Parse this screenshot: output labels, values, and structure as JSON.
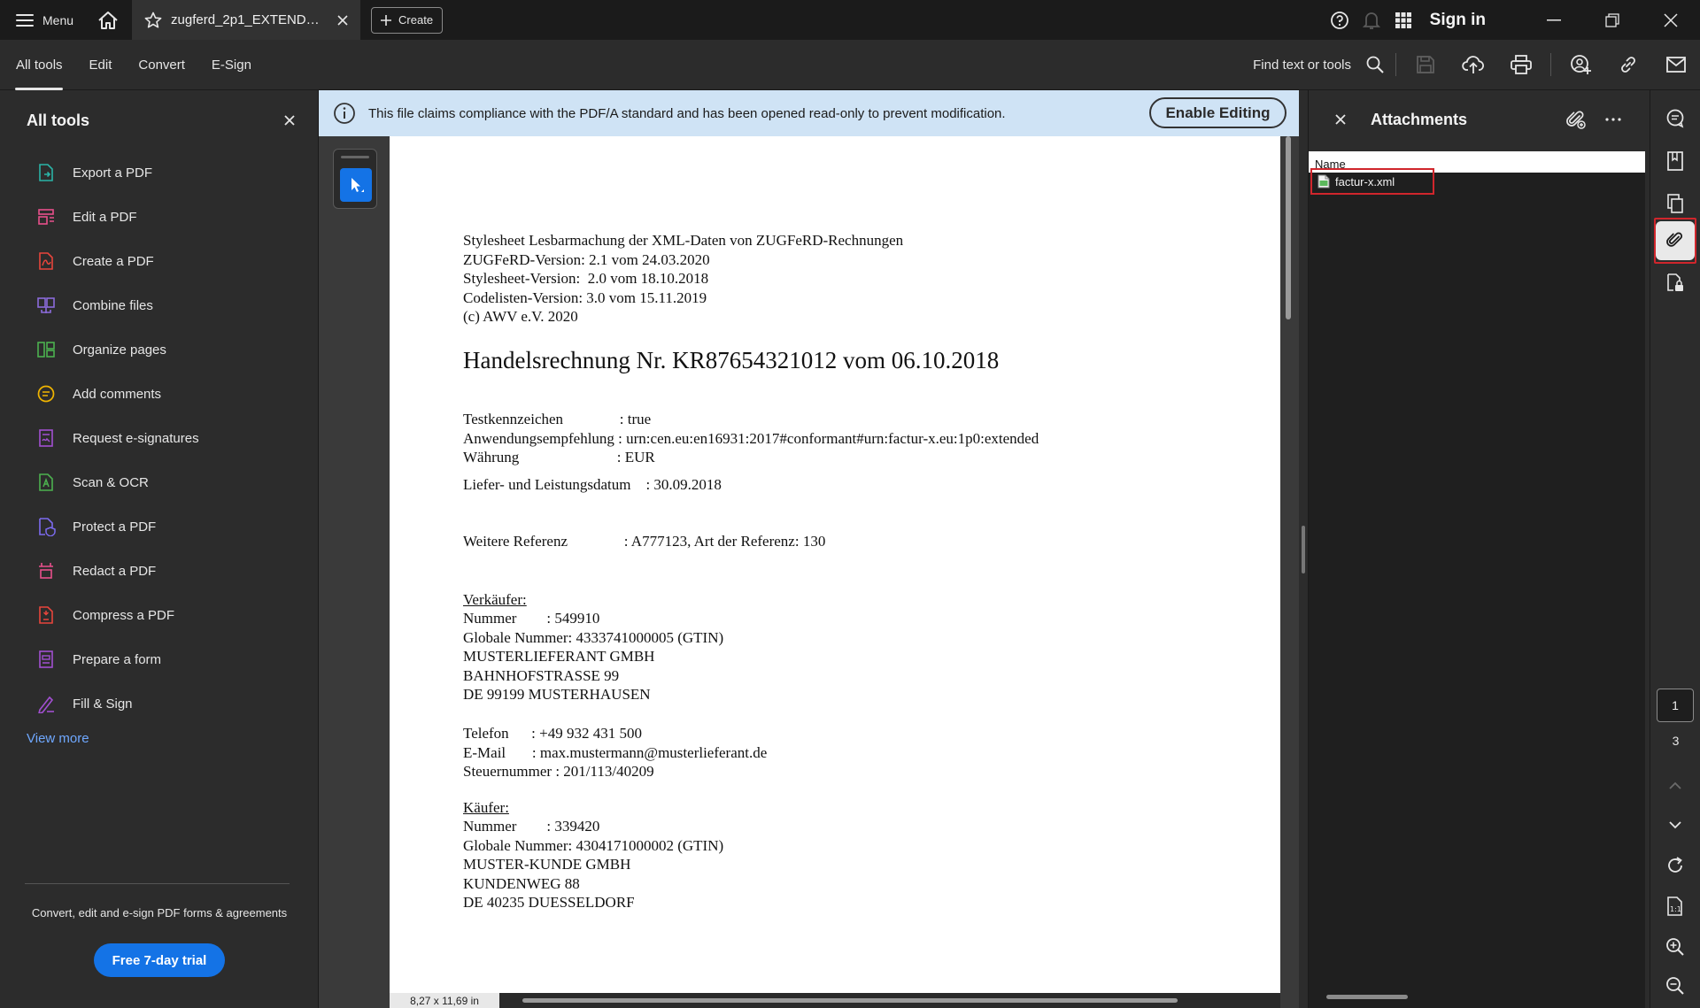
{
  "titlebar": {
    "menu_label": "Menu",
    "tab_title": "zugferd_2p1_EXTENDE...",
    "create_label": "Create",
    "signin_label": "Sign in"
  },
  "toolbar": {
    "tabs": [
      "All tools",
      "Edit",
      "Convert",
      "E-Sign"
    ],
    "find_label": "Find text or tools"
  },
  "left_panel": {
    "title": "All tools",
    "items": [
      {
        "label": "Export a PDF",
        "icon": "export-pdf-icon",
        "color": "#2ab3a6"
      },
      {
        "label": "Edit a PDF",
        "icon": "edit-pdf-icon",
        "color": "#e8508b"
      },
      {
        "label": "Create a PDF",
        "icon": "create-pdf-icon",
        "color": "#e8453c"
      },
      {
        "label": "Combine files",
        "icon": "combine-files-icon",
        "color": "#8c6bdb"
      },
      {
        "label": "Organize pages",
        "icon": "organize-pages-icon",
        "color": "#4cb14f"
      },
      {
        "label": "Add comments",
        "icon": "add-comments-icon",
        "color": "#f0b400"
      },
      {
        "label": "Request e-signatures",
        "icon": "request-esignatures-icon",
        "color": "#a24fd1"
      },
      {
        "label": "Scan & OCR",
        "icon": "scan-ocr-icon",
        "color": "#4cb14f"
      },
      {
        "label": "Protect a PDF",
        "icon": "protect-pdf-icon",
        "color": "#7c6bf0"
      },
      {
        "label": "Redact a PDF",
        "icon": "redact-pdf-icon",
        "color": "#e8508b"
      },
      {
        "label": "Compress a PDF",
        "icon": "compress-pdf-icon",
        "color": "#e8453c"
      },
      {
        "label": "Prepare a form",
        "icon": "prepare-form-icon",
        "color": "#a24fd1"
      },
      {
        "label": "Fill & Sign",
        "icon": "fill-sign-icon",
        "color": "#a24fd1"
      }
    ],
    "view_more": "View more",
    "promo_text": "Convert, edit and e-sign PDF forms & agreements",
    "trial_button": "Free 7-day trial"
  },
  "infobar": {
    "message": "This file claims compliance with the PDF/A standard and has been opened read-only to prevent modification.",
    "enable_button": "Enable Editing"
  },
  "document": {
    "header_lines": "Stylesheet Lesbarmachung der XML-Daten von ZUGFeRD-Rechnungen\nZUGFeRD-Version: 2.1 vom 24.03.2020\nStylesheet-Version:  2.0 vom 18.10.2018\nCodelisten-Version: 3.0 vom 15.11.2019\n(c) AWV e.V. 2020",
    "heading": "Handelsrechnung Nr. KR87654321012 vom 06.10.2018",
    "meta_lines": "Testkennzeichen               : true\nAnwendungsempfehlung : urn:cen.eu:en16931:2017#conformant#urn:factur-x.eu:1p0:extended\nWährung                          : EUR",
    "delivery_line": "Liefer- und Leistungsdatum    : 30.09.2018",
    "reference_line": "Weitere Referenz               : A777123, Art der Referenz: 130",
    "seller_title": "Verkäufer:",
    "seller_lines": "Nummer        : 549910\nGlobale Nummer: 4333741000005 (GTIN)\nMUSTERLIEFERANT GMBH\nBAHNHOFSTRASSE 99\nDE 99199 MUSTERHAUSEN",
    "contact_lines": "Telefon      : +49 932 431 500\nE-Mail       : max.mustermann@musterlieferant.de\nSteuernummer : 201/113/40209",
    "buyer_title": "Käufer:",
    "buyer_lines": "Nummer        : 339420\nGlobale Nummer: 4304171000002 (GTIN)\nMUSTER-KUNDE GMBH\nKUNDENWEG 88\nDE 40235 DUESSELDORF",
    "page_size": "8,27 x 11,69 in"
  },
  "attachments": {
    "title": "Attachments",
    "column_name": "Name",
    "files": [
      {
        "name": "factur-x.xml"
      }
    ]
  },
  "navigation": {
    "current_page": "1",
    "total_pages": "3"
  },
  "colors": {
    "accent": "#1473e6",
    "highlight": "#d0262c",
    "infobar_bg": "#cfe3f5"
  }
}
